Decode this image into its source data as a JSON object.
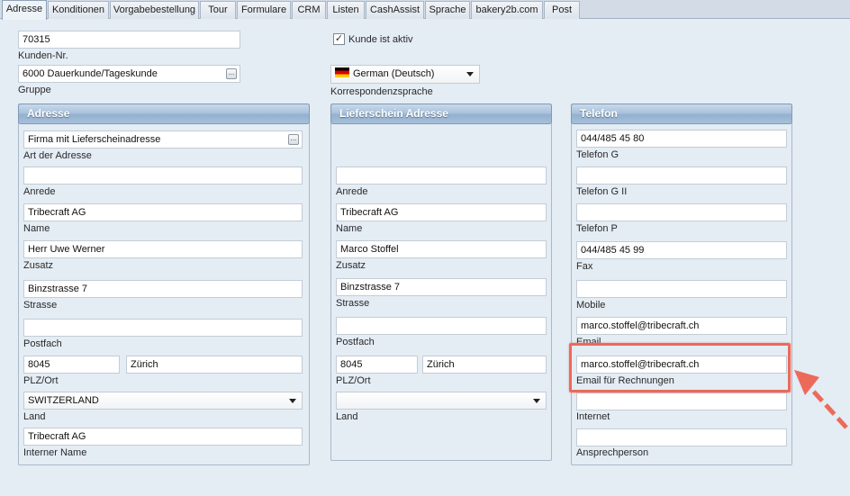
{
  "tabs": [
    "Adresse",
    "Konditionen",
    "Vorgabebestellung",
    "Tour",
    "Formulare",
    "CRM",
    "Listen",
    "CashAssist",
    "Sprache",
    "bakery2b.com",
    "Post"
  ],
  "header": {
    "kunden_nr_value": "70315",
    "kunden_nr_label": "Kunden-Nr.",
    "gruppe_value": "6000 Dauerkunde/Tageskunde",
    "gruppe_label": "Gruppe",
    "kunde_aktiv_label": "Kunde ist aktiv",
    "kunde_aktiv_checked": true,
    "sprache_value": "German (Deutsch)",
    "sprache_label": "Korrespondenzsprache",
    "dots": "..."
  },
  "adresse": {
    "title": "Adresse",
    "art_value": "Firma mit Lieferscheinadresse",
    "art_label": "Art der Adresse",
    "anrede_value": "",
    "anrede_label": "Anrede",
    "name_value": "Tribecraft AG",
    "name_label": "Name",
    "zusatz_value": "Herr Uwe Werner",
    "zusatz_label": "Zusatz",
    "strasse_value": "Binzstrasse 7",
    "strasse_label": "Strasse",
    "postfach_value": "",
    "postfach_label": "Postfach",
    "plz_value": "8045",
    "ort_value": "Zürich",
    "plzort_label": "PLZ/Ort",
    "land_value": "SWITZERLAND",
    "land_label": "Land",
    "intern_value": "Tribecraft AG",
    "intern_label": "Interner Name"
  },
  "lieferschein": {
    "title": "Lieferschein Adresse",
    "anrede_value": "",
    "anrede_label": "Anrede",
    "name_value": "Tribecraft AG",
    "name_label": "Name",
    "zusatz_value": "Marco Stoffel",
    "zusatz_label": "Zusatz",
    "strasse_value": "Binzstrasse 7",
    "strasse_label": "Strasse",
    "postfach_value": "",
    "postfach_label": "Postfach",
    "plz_value": "8045",
    "ort_value": "Zürich",
    "plzort_label": "PLZ/Ort",
    "land_value": "",
    "land_label": "Land"
  },
  "telefon": {
    "title": "Telefon",
    "g_value": "044/485 45 80",
    "g_label": "Telefon G",
    "g2_value": "",
    "g2_label": "Telefon G II",
    "p_value": "",
    "p_label": "Telefon P",
    "fax_value": "044/485 45 99",
    "fax_label": "Fax",
    "mobile_value": "",
    "mobile_label": "Mobile",
    "email_value": "marco.stoffel@tribecraft.ch",
    "email_label": "Email",
    "email_rechnung_value": "marco.stoffel@tribecraft.ch",
    "email_rechnung_label": "Email für Rechnungen",
    "internet_value": "",
    "internet_label": "Internet",
    "ansprech_value": "",
    "ansprech_label": "Ansprechperson"
  },
  "colors": {
    "highlight": "#ec6a5a",
    "group_header": "#a9c2dc"
  }
}
